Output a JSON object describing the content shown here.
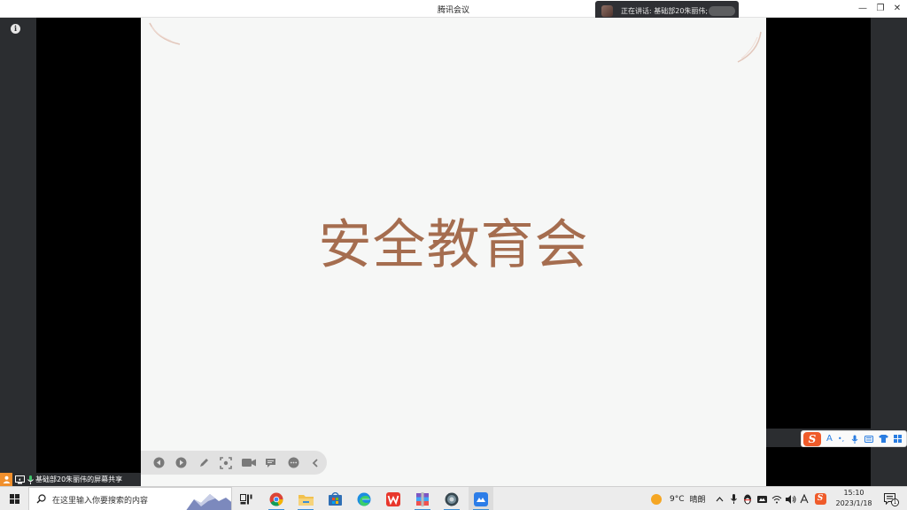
{
  "window": {
    "title": "腾讯会议"
  },
  "speaking": {
    "prefix": "正在讲话:",
    "name": "基础部20朱丽伟;"
  },
  "slide": {
    "title": "安全教育会",
    "title_color": "#a56d4f",
    "background": "#f6f7f6"
  },
  "slide_toolbar": {
    "buttons": [
      "previous-icon",
      "next-icon",
      "pen-icon",
      "screenshot-icon",
      "camera-icon",
      "comment-icon",
      "more-icon",
      "collapse-icon"
    ]
  },
  "share": {
    "label": "基础部20朱丽伟的屏幕共享"
  },
  "ime": {
    "logo": "S",
    "items": [
      "A",
      "•,",
      "mic",
      "keyboard",
      "shirt",
      "grid"
    ]
  },
  "taskbar": {
    "search_placeholder": "在这里输入你要搜索的内容",
    "apps": [
      "task-view",
      "chrome",
      "file-explorer",
      "store",
      "edge",
      "wps",
      "winrar",
      "app-sphere",
      "tencent-meeting"
    ],
    "weather": {
      "temp": "9°C",
      "condition": "晴朗"
    },
    "clock": {
      "time": "15:10",
      "date": "2023/1/18"
    },
    "notifications": "1"
  }
}
